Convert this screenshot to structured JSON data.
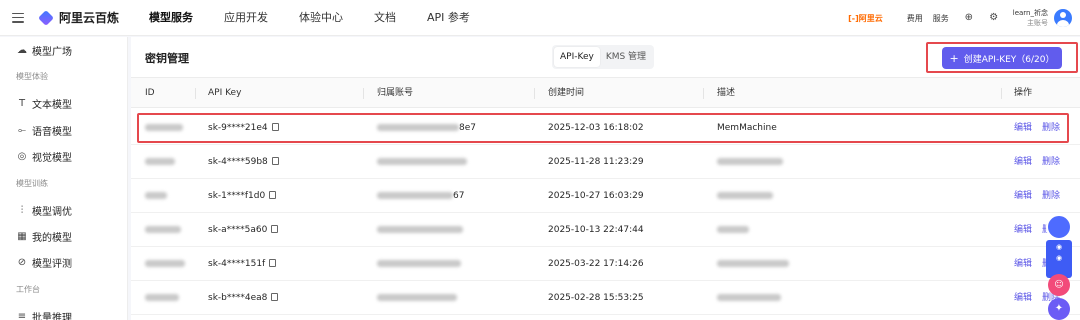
{
  "header": {
    "brand": "阿里云百炼",
    "nav": [
      "模型服务",
      "应用开发",
      "体验中心",
      "文档",
      "API 参考"
    ],
    "aliyun": "[-]阿里云",
    "links": [
      "费用",
      "服务"
    ],
    "user_name": "learn_祈念",
    "user_role": "主账号"
  },
  "sidebar": {
    "items": [
      {
        "label": "模型广场",
        "icon": "model-square-icon"
      },
      {
        "label": "文本模型",
        "icon": "text-icon"
      },
      {
        "label": "语音模型",
        "icon": "waveform-icon"
      },
      {
        "label": "视觉模型",
        "icon": "camera-icon"
      },
      {
        "label": "模型调优",
        "icon": "sliders-icon"
      },
      {
        "label": "我的模型",
        "icon": "grid-icon"
      },
      {
        "label": "模型评测",
        "icon": "compass-icon"
      },
      {
        "label": "批量推理",
        "icon": "list-icon"
      }
    ],
    "sections": [
      "模型体验",
      "模型训练",
      "工作台"
    ]
  },
  "panel": {
    "title": "密钥管理",
    "tabs": [
      "API-Key",
      "KMS 管理"
    ],
    "active_tab": "API-Key",
    "create_button": "创建API-KEY（6/20）"
  },
  "table": {
    "columns": [
      "ID",
      "API Key",
      "归属账号",
      "创建时间",
      "描述",
      "操作"
    ],
    "rows": [
      {
        "api_key": "sk-9****21e4",
        "account_suffix": "8e7",
        "created": "2025-12-03 16:18:02",
        "description": "MemMachine"
      },
      {
        "api_key": "sk-4****59b8",
        "account_suffix": "",
        "created": "2025-11-28 11:23:29",
        "description": ""
      },
      {
        "api_key": "sk-1****f1d0",
        "account_suffix": "67",
        "created": "2025-10-27 16:03:29",
        "description": ""
      },
      {
        "api_key": "sk-a****5a60",
        "account_suffix": "",
        "created": "2025-10-13 22:47:44",
        "description": ""
      },
      {
        "api_key": "sk-4****151f",
        "account_suffix": "",
        "created": "2025-03-22 17:14:26",
        "description": ""
      },
      {
        "api_key": "sk-b****4ea8",
        "account_suffix": "",
        "created": "2025-02-28 15:53:25",
        "description": ""
      }
    ],
    "actions": [
      "编辑",
      "删除"
    ]
  },
  "colors": {
    "accent": "#615ced",
    "highlight": "#e5484d",
    "link": "#5a55e6"
  }
}
